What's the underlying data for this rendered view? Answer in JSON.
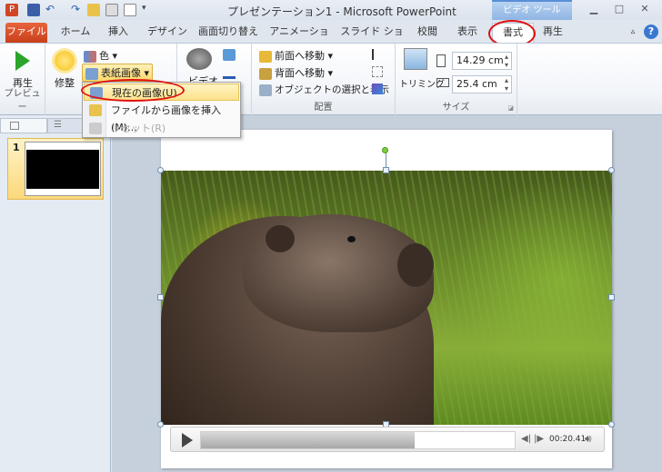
{
  "window": {
    "title": "プレゼンテーション1 - Microsoft PowerPoint",
    "context_tab": "ビデオ ツール"
  },
  "tabs": [
    {
      "label": "ファイル"
    },
    {
      "label": "ホーム"
    },
    {
      "label": "挿入"
    },
    {
      "label": "デザイン"
    },
    {
      "label": "画面切り替え"
    },
    {
      "label": "アニメーション"
    },
    {
      "label": "スライド ショー"
    },
    {
      "label": "校閲"
    },
    {
      "label": "表示"
    },
    {
      "label": "書式",
      "active": true,
      "highlighted": true
    },
    {
      "label": "再生"
    }
  ],
  "ribbon": {
    "preview": {
      "play": "再生",
      "label": "プレビュー"
    },
    "adjust": {
      "correct": "修整",
      "color": "色",
      "poster": "表紙画像",
      "poster_open": true
    },
    "video_styles": {
      "label_partial": "ビデオ"
    },
    "arrange": {
      "bring_forward": "前面へ移動",
      "send_backward": "背面へ移動",
      "selection_pane": "オブジェクトの選択と表示",
      "label": "配置"
    },
    "size": {
      "crop": "トリミング",
      "height": "14.29 cm",
      "width": "25.4 cm",
      "label": "サイズ"
    }
  },
  "poster_menu": [
    {
      "label": "現在の画像(U)",
      "hover": true,
      "highlighted": true
    },
    {
      "label": "ファイルから画像を挿入(M)..."
    },
    {
      "label": "リセット(R)",
      "disabled": true
    }
  ],
  "slides_pane": {
    "slides": [
      {
        "number": "1"
      }
    ]
  },
  "player": {
    "time": "00:20.41",
    "progress": 0.68
  },
  "colors": {
    "file_tab": "#d9532c",
    "context_tab": "#8fb5e4",
    "highlight_circle": "#e01010",
    "menu_hover": "#fde38a"
  }
}
